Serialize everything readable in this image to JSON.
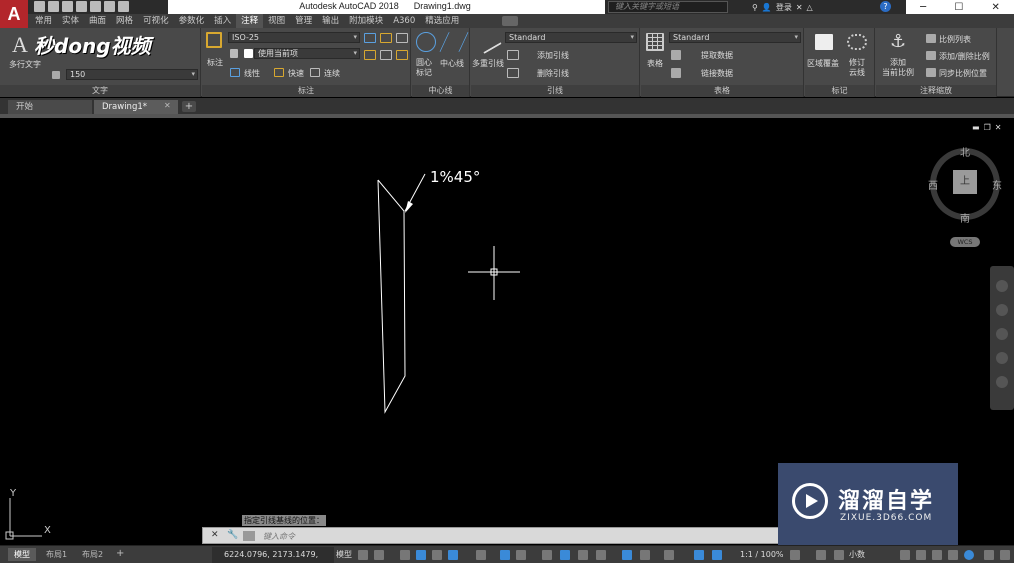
{
  "app": {
    "logo": "A",
    "title": "Autodesk AutoCAD 2018      Drawing1.dwg",
    "search_placeholder": "键入关键字或短语",
    "login": "登录"
  },
  "ribbon_tabs": [
    "常用",
    "实体",
    "曲面",
    "网格",
    "可视化",
    "参数化",
    "插入",
    "注释",
    "视图",
    "管理",
    "输出",
    "附加模块",
    "A360",
    "精选应用"
  ],
  "ribbon_active_tab": "注释",
  "ribbon": {
    "text_panel": {
      "title": "文字",
      "mtext_label": "多行文字",
      "text_height": "150",
      "watermark_text": "秒dong视频"
    },
    "dim_panel": {
      "title": "标注",
      "dim_label": "标注",
      "dim_style": "ISO-25",
      "layer": "使用当前项",
      "linear": "线性",
      "quick": "快速",
      "continuous": "连续"
    },
    "centerline_panel": {
      "title": "中心线",
      "center_mark": "圆心\n标记",
      "centerline": "中心线"
    },
    "leader_panel": {
      "title": "引线",
      "multileader": "多重引线",
      "style": "Standard",
      "add": "添加引线",
      "remove": "删除引线"
    },
    "table_panel": {
      "title": "表格",
      "table": "表格",
      "style": "Standard",
      "extract": "提取数据",
      "link": "链接数据"
    },
    "markup_panel": {
      "title": "标记",
      "wipeout": "区域覆盖",
      "revcloud": "修订\n云线"
    },
    "scale_panel": {
      "title": "注释缩放",
      "add_current": "添加\n当前比例",
      "scale_list": "比例列表",
      "add_delete": "添加/删除比例",
      "sync": "同步比例位置"
    }
  },
  "doc_tabs": [
    "开始",
    "Drawing1*"
  ],
  "drawing": {
    "annotation": "1%45°"
  },
  "viewcube": {
    "top": "上",
    "north": "北",
    "south": "南",
    "east": "东",
    "west": "西",
    "wcs": "WCS"
  },
  "command": {
    "prompt": "指定引线基线的位置：",
    "placeholder": "键入命令"
  },
  "watermark": {
    "title": "溜溜自学",
    "url": "ZIXUE.3D66.COM"
  },
  "status": {
    "layout_tabs": [
      "模型",
      "布局1",
      "布局2"
    ],
    "coordinates": "6224.0796, 2173.1479, 0.0000",
    "model": "模型",
    "scale": "1:1 / 100%",
    "units": "小数"
  }
}
